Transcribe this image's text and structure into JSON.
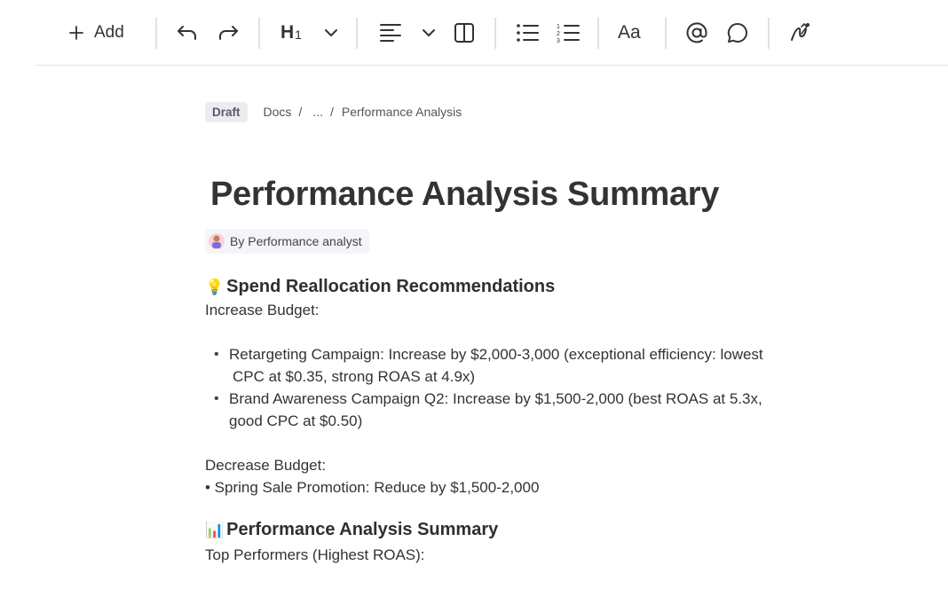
{
  "toolbar": {
    "add_label": "Add",
    "heading_label": "H",
    "heading_level": "1",
    "text_style_label": "Aa",
    "icons": [
      "plus-icon",
      "undo-icon",
      "redo-icon",
      "chevron-down-icon",
      "align-left-icon",
      "columns-icon",
      "bulleted-list-icon",
      "numbered-list-icon",
      "mention-icon",
      "comment-icon",
      "ai-pen-icon"
    ]
  },
  "breadcrumb": {
    "status": "Draft",
    "items": [
      "Docs",
      "...",
      "Performance Analysis"
    ],
    "separator": "/"
  },
  "document": {
    "title": "Performance Analysis Summary",
    "author": "By Performance analyst",
    "sections": [
      {
        "emoji": "💡",
        "heading": "Spend Reallocation Recommendations",
        "increase_label": "Increase Budget:",
        "increase_items": [
          {
            "line1": "Retargeting Campaign: Increase by $2,000-3,000 (exceptional efficiency: lowest",
            "line2": "CPC at $0.35, strong ROAS at 4.9x)"
          },
          {
            "line1": "Brand Awareness Campaign Q2: Increase by $1,500-2,000 (best ROAS at 5.3x,",
            "line2": "good CPC at $0.50)"
          }
        ],
        "decrease_label": "Decrease Budget:",
        "decrease_item": "• Spring Sale Promotion: Reduce by $1,500-2,000"
      },
      {
        "emoji": "📊",
        "heading": "Performance Analysis Summary",
        "subheading": "Top Performers (Highest ROAS):"
      }
    ]
  },
  "colors": {
    "accent_badge_bg": "#eeeaf2",
    "text": "#2b2b2b",
    "divider": "#e3e3e3"
  }
}
